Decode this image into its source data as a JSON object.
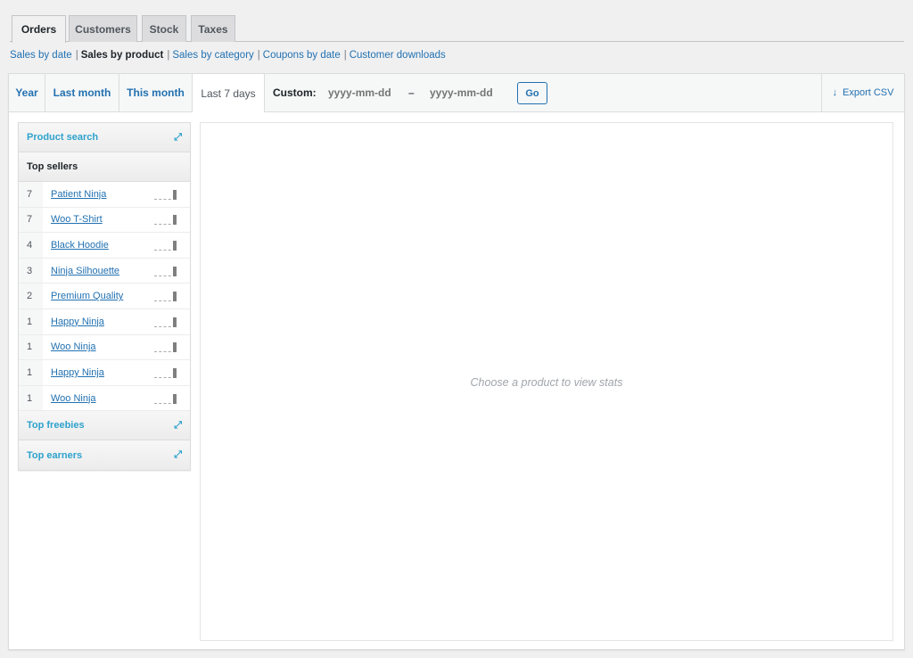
{
  "nav_tabs": [
    {
      "label": "Orders",
      "active": true
    },
    {
      "label": "Customers",
      "active": false
    },
    {
      "label": "Stock",
      "active": false
    },
    {
      "label": "Taxes",
      "active": false
    }
  ],
  "report_links": [
    {
      "label": "Sales by date",
      "current": false
    },
    {
      "label": "Sales by product",
      "current": true
    },
    {
      "label": "Sales by category",
      "current": false
    },
    {
      "label": "Coupons by date",
      "current": false
    },
    {
      "label": "Customer downloads",
      "current": false
    }
  ],
  "separator": "|",
  "range_tabs": [
    {
      "label": "Year",
      "active": false
    },
    {
      "label": "Last month",
      "active": false
    },
    {
      "label": "This month",
      "active": false
    },
    {
      "label": "Last 7 days",
      "active": true
    }
  ],
  "custom_range": {
    "label": "Custom:",
    "start_placeholder": "yyyy-mm-dd",
    "end_placeholder": "yyyy-mm-dd",
    "dash": "–",
    "go_label": "Go"
  },
  "export": {
    "icon": "download-arrow-icon",
    "glyph": "↓",
    "label": "Export CSV"
  },
  "sidebar": {
    "product_search": {
      "label": "Product search",
      "icon": "expand-icon",
      "glyph": "⤢"
    },
    "top_sellers": {
      "label": "Top sellers",
      "items": [
        {
          "count": "7",
          "name": "Patient Ninja"
        },
        {
          "count": "7",
          "name": "Woo T-Shirt"
        },
        {
          "count": "4",
          "name": "Black Hoodie"
        },
        {
          "count": "3",
          "name": "Ninja Silhouette"
        },
        {
          "count": "2",
          "name": "Premium Quality"
        },
        {
          "count": "1",
          "name": "Happy Ninja"
        },
        {
          "count": "1",
          "name": "Woo Ninja"
        },
        {
          "count": "1",
          "name": "Happy Ninja"
        },
        {
          "count": "1",
          "name": "Woo Ninja"
        }
      ]
    },
    "top_freebies": {
      "label": "Top freebies",
      "icon": "expand-icon",
      "glyph": "⤢"
    },
    "top_earners": {
      "label": "Top earners",
      "icon": "expand-icon",
      "glyph": "⤢"
    }
  },
  "chart": {
    "placeholder": "Choose a product to view stats"
  }
}
